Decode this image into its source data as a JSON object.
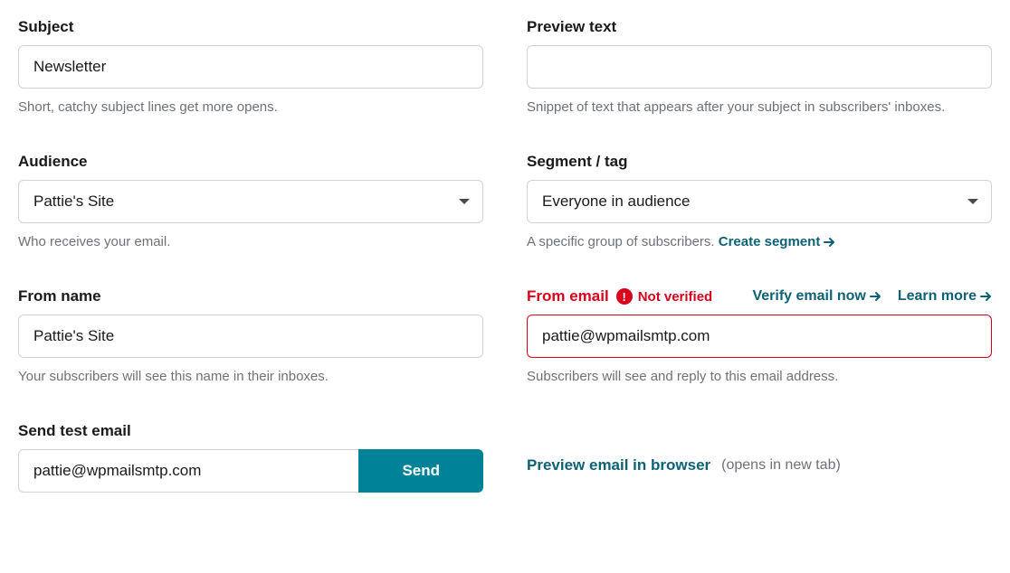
{
  "subject": {
    "label": "Subject",
    "value": "Newsletter",
    "helper": "Short, catchy subject lines get more opens."
  },
  "preview_text": {
    "label": "Preview text",
    "value": "",
    "helper": "Snippet of text that appears after your subject in subscribers' inboxes."
  },
  "audience": {
    "label": "Audience",
    "value": "Pattie's Site",
    "helper": "Who receives your email."
  },
  "segment": {
    "label": "Segment / tag",
    "value": "Everyone in audience",
    "helper_prefix": "A specific group of subscribers. ",
    "link": "Create segment"
  },
  "from_name": {
    "label": "From name",
    "value": "Pattie's Site",
    "helper": "Your subscribers will see this name in their inboxes."
  },
  "from_email": {
    "label": "From email",
    "badge_text": "Not verified",
    "verify_link": "Verify email now",
    "learn_link": "Learn more",
    "value": "pattie@wpmailsmtp.com",
    "helper": "Subscribers will see and reply to this email address."
  },
  "send_test": {
    "label": "Send test email",
    "value": "pattie@wpmailsmtp.com",
    "button": "Send"
  },
  "preview_link": {
    "label": "Preview email in browser",
    "suffix": "(opens in new tab)"
  }
}
